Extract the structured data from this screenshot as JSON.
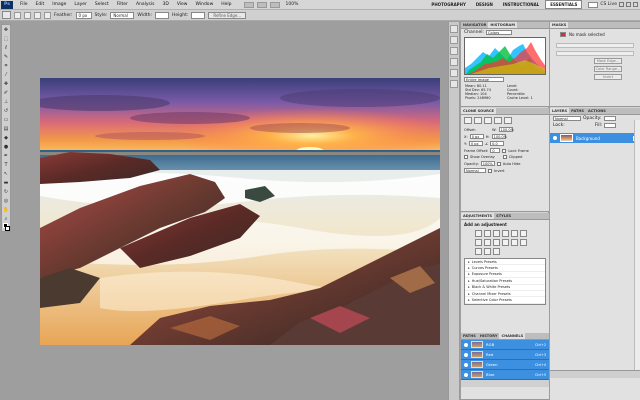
{
  "menubar": {
    "logo": "Ps",
    "items": [
      "File",
      "Edit",
      "Image",
      "Layer",
      "Select",
      "Filter",
      "Analysis",
      "3D",
      "View",
      "Window",
      "Help"
    ],
    "zoom": "100%",
    "workspaces": [
      "PHOTOGRAPHY",
      "DESIGN",
      "INSTRUCTIONAL",
      "ESSENTIALS"
    ],
    "active_workspace": "ESSENTIALS",
    "cs_live": "CS Live"
  },
  "options": {
    "feather_label": "Feather:",
    "feather_value": "0 px",
    "style_label": "Style:",
    "style_value": "Normal",
    "width_label": "Width:",
    "height_label": "Height:",
    "refine_edge": "Refine Edge..."
  },
  "histogram": {
    "tabs": [
      "NAVIGATOR",
      "HISTOGRAM"
    ],
    "channel_label": "Channel:",
    "channel_value": "Colors",
    "source_value": "Entire Image",
    "stats": [
      {
        "label": "Mean:",
        "value": "80.11"
      },
      {
        "label": "Level:",
        "value": ""
      },
      {
        "label": "Std Dev:",
        "value": "65.74"
      },
      {
        "label": "Count:",
        "value": ""
      },
      {
        "label": "Median:",
        "value": "104"
      },
      {
        "label": "Percentile:",
        "value": ""
      },
      {
        "label": "Pixels:",
        "value": "246960"
      },
      {
        "label": "Cache Level:",
        "value": "1"
      }
    ]
  },
  "clone": {
    "tabs": [
      "CLONE SOURCE"
    ],
    "offset_label": "Offset:",
    "w_value": "100.0%",
    "h_value": "100.0%",
    "x_value": "0 px",
    "y_value": "0 px",
    "angle_value": "0.0",
    "frame_offset_label": "Frame Offset:",
    "frame_offset_value": "0",
    "lock_frame": "Lock Frame",
    "show_overlay": "Show Overlay",
    "clipped": "Clipped",
    "opacity_label": "Opacity:",
    "opacity_value": "100%",
    "auto_hide": "Auto Hide",
    "blend_value": "Normal",
    "invert": "Invert"
  },
  "adjustments": {
    "tabs": [
      "ADJUSTMENTS",
      "STYLES"
    ],
    "title": "Add an adjustment",
    "presets": [
      "Levels Presets",
      "Curves Presets",
      "Exposure Presets",
      "Hue/Saturation Presets",
      "Black & White Presets",
      "Channel Mixer Presets",
      "Selective Color Presets"
    ]
  },
  "channels": {
    "tabs": [
      "PATHS",
      "HISTORY",
      "CHANNELS"
    ],
    "items": [
      {
        "name": "RGB",
        "shortcut": "Ctrl+2"
      },
      {
        "name": "Red",
        "shortcut": "Ctrl+3"
      },
      {
        "name": "Green",
        "shortcut": "Ctrl+4"
      },
      {
        "name": "Blue",
        "shortcut": "Ctrl+5"
      }
    ]
  },
  "masks": {
    "tabs": [
      "MASKS"
    ],
    "no_mask": "No mask selected",
    "mask_edge": "Mask Edge...",
    "color_range": "Color Range...",
    "invert": "Invert"
  },
  "layers": {
    "tabs": [
      "LAYERS",
      "PATHS",
      "ACTIONS"
    ],
    "blend_value": "Normal",
    "opacity_label": "Opacity:",
    "lock_label": "Lock:",
    "fill_label": "Fill:",
    "layer_name": "Background"
  },
  "colors": {
    "selection_blue": "#3d8fe0",
    "ui_gray": "#d3d3d3"
  }
}
